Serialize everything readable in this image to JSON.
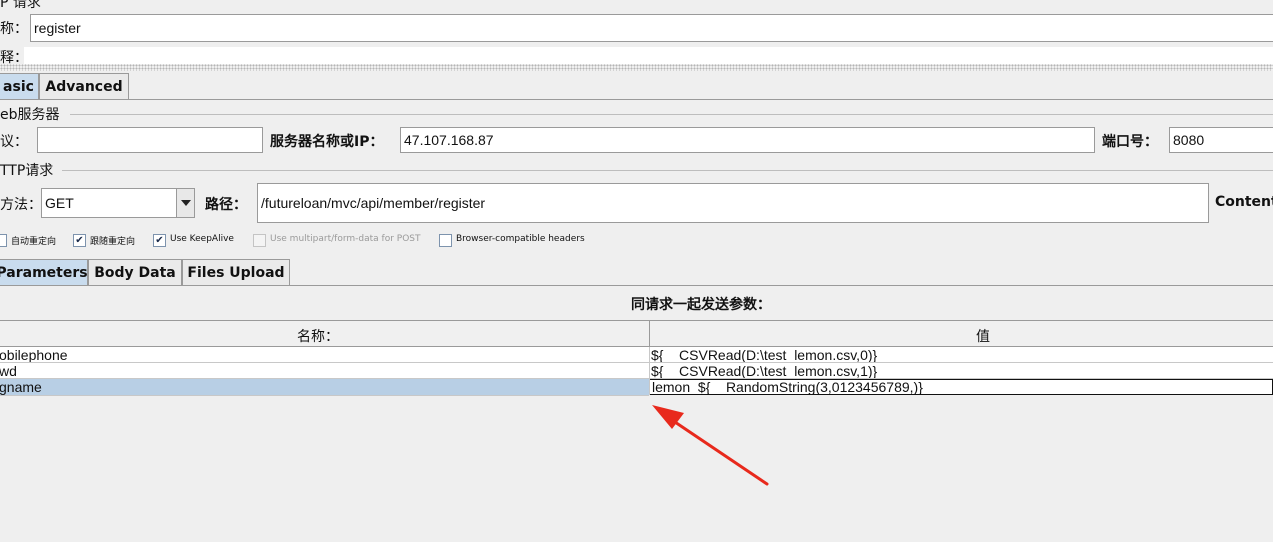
{
  "header": {
    "title_partial": "P 请求",
    "name_label": "称：",
    "name_value": "register",
    "comment_label": "释："
  },
  "main_tabs": [
    {
      "label": "asic",
      "selected": true
    },
    {
      "label": "Advanced",
      "selected": false
    }
  ],
  "web_server": {
    "section_title": "eb服务器",
    "protocol_label": "议：",
    "protocol_value": "",
    "server_label": "服务器名称或IP：",
    "server_value": "47.107.168.87",
    "port_label": "端口号：",
    "port_value": "8080"
  },
  "http_request": {
    "section_title": "TTP请求",
    "method_label": "方法：",
    "method_value": "GET",
    "path_label": "路径：",
    "path_value": "/futureloan/mvc/api/member/register",
    "content_label": "Content"
  },
  "options": [
    {
      "label": "自动重定向",
      "checked": false,
      "disabled": false
    },
    {
      "label": "跟随重定向",
      "checked": true,
      "disabled": false
    },
    {
      "label": "Use KeepAlive",
      "checked": true,
      "disabled": false
    },
    {
      "label": "Use multipart/form-data for POST",
      "checked": false,
      "disabled": true
    },
    {
      "label": "Browser-compatible headers",
      "checked": false,
      "disabled": false
    }
  ],
  "sub_tabs": [
    {
      "label": "Parameters",
      "selected": true
    },
    {
      "label": "Body Data",
      "selected": false
    },
    {
      "label": "Files Upload",
      "selected": false
    }
  ],
  "params": {
    "caption": "同请求一起发送参数：",
    "columns": [
      "名称：",
      "值"
    ],
    "rows": [
      {
        "name": "obilephone",
        "value": "${__CSVRead(D:\\test_lemon.csv,0)}"
      },
      {
        "name": "wd",
        "value": "${__CSVRead(D:\\test_lemon.csv,1)}"
      },
      {
        "name": "gname",
        "value": "lemon_${__RandomString(3,0123456789,)}"
      }
    ],
    "selected_row": 2
  },
  "colors": {
    "selection": "#b8cfe5",
    "tab_selected": "#c9dcee",
    "arrow": "#e8291c"
  }
}
